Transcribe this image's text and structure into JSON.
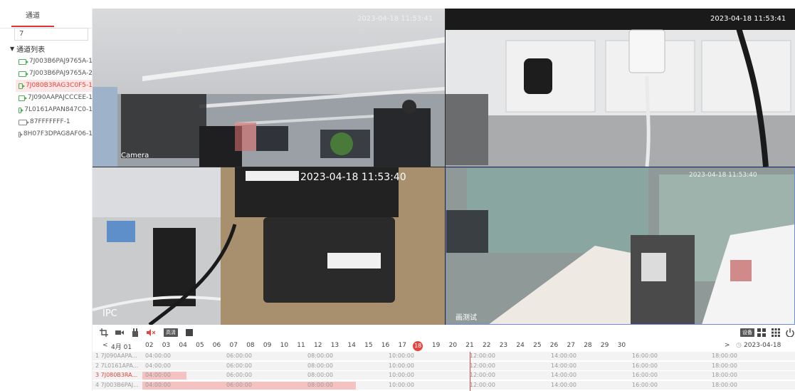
{
  "sidebar": {
    "tab_label": "通道",
    "search_value": "7",
    "tree_title": "通道列表",
    "items": [
      {
        "label": "7J003B6PAJ9765A-1",
        "online": true,
        "active": false
      },
      {
        "label": "7J003B6PAJ9765A-2",
        "online": true,
        "active": false
      },
      {
        "label": "7J080B3RAG3C0F5-1",
        "online": true,
        "active": true
      },
      {
        "label": "7J090AAPAJCCCEE-1",
        "online": true,
        "active": false
      },
      {
        "label": "7L0161APAN847C0-1",
        "online": true,
        "active": false
      },
      {
        "label": "87FFFFFFF-1",
        "online": false,
        "active": false
      },
      {
        "label": "8H07F3DPAG8AF06-1",
        "online": false,
        "active": false
      }
    ]
  },
  "video": {
    "cells": [
      {
        "timestamp": "2023-04-18 11:53:41",
        "label": "Camera"
      },
      {
        "timestamp": "2023-04-18 11:53:41",
        "label": ""
      },
      {
        "timestamp": "2023-04-18 11:53:40",
        "label": "IPC"
      },
      {
        "timestamp": "2023-04-18 11:53:40",
        "label": "画测试"
      }
    ]
  },
  "toolbar": {
    "hd_badge": "高清",
    "device_badge": "设备"
  },
  "dates": {
    "month_label": "4月 01",
    "days": [
      "02",
      "03",
      "04",
      "05",
      "06",
      "07",
      "08",
      "09",
      "10",
      "11",
      "12",
      "13",
      "14",
      "15",
      "16",
      "17",
      "18",
      "19",
      "20",
      "21",
      "22",
      "23",
      "24",
      "25",
      "26",
      "27",
      "28",
      "29",
      "30"
    ],
    "today": "18",
    "current_date": "2023-04-18"
  },
  "timeline": {
    "rows": [
      {
        "name": "1 7J090AAPA...",
        "active": false
      },
      {
        "name": "2 7L0161APA...",
        "active": false
      },
      {
        "name": "3 7J080B3RA...",
        "active": true
      },
      {
        "name": "4 7J003B6PAJ...",
        "active": false
      }
    ],
    "times": [
      "04:00:00",
      "06:00:00",
      "08:00:00",
      "10:00:00",
      "12:00:00",
      "14:00:00",
      "16:00:00",
      "18:00:00"
    ]
  },
  "colors": {
    "accent": "#e2453e",
    "online": "#4caf50",
    "offline": "#8a8a8a"
  }
}
